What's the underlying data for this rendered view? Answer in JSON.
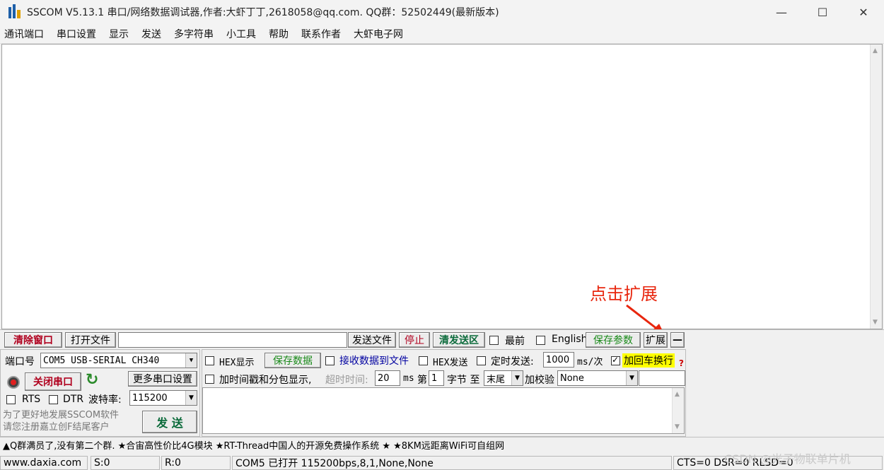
{
  "window": {
    "title": "SSCOM V5.13.1 串口/网络数据调试器,作者:大虾丁丁,2618058@qq.com. QQ群：52502449(最新版本)",
    "min": "—",
    "max": "☐",
    "close": "✕"
  },
  "menu": [
    "通讯端口",
    "串口设置",
    "显示",
    "发送",
    "多字符串",
    "小工具",
    "帮助",
    "联系作者",
    "大虾电子网"
  ],
  "annotation": "点击扩展",
  "toolbar": {
    "clear": "清除窗口",
    "open_file": "打开文件",
    "file_path": "",
    "send_file": "发送文件",
    "stop": "停止",
    "clear_send": "清发送区",
    "top_label": "最前",
    "english_label": "English",
    "save_params": "保存参数",
    "expand": "扩展",
    "collapse": "—"
  },
  "port": {
    "port_label": "端口号",
    "port_value": "COM5 USB-SERIAL CH340",
    "more_settings": "更多串口设置",
    "close_port": "关闭串口",
    "rts": "RTS",
    "dtr": "DTR",
    "baud_label": "波特率:",
    "baud_value": "115200",
    "hint": "为了更好地发展SSCOM软件\n请您注册嘉立创F结尾客户"
  },
  "options": {
    "hex_display": "HEX显示",
    "save_data": "保存数据",
    "recv_to_file": "接收数据到文件",
    "hex_send": "HEX发送",
    "timed_send": "定时发送:",
    "interval": "1000",
    "interval_unit": "ms/次",
    "add_crlf": "加回车换行",
    "timestamp": "加时间戳和分包显示,",
    "timeout_label": "超时时间:",
    "timeout": "20",
    "timeout_unit": "ms",
    "byte_from_label": "第",
    "byte_from": "1",
    "byte_label": "字节 至",
    "byte_to": "末尾",
    "checksum_label": "加校验",
    "checksum": "None",
    "send": "发  送",
    "help": "?"
  },
  "ads": "▲Q群满员了,没有第二个群. ★合宙高性价比4G模块 ★RT-Thread中国人的开源免费操作系统 ★ ★8KM远距离WiFi可自组网",
  "status": {
    "site": "www.daxia.com",
    "s": "S:0",
    "r": "R:0",
    "port_state": "COM5 已打开  115200bps,8,1,None,None",
    "lines": "CTS=0 DSR=0 RLSD=0"
  },
  "watermark": "CSDN @光子物联单片机",
  "colors": {
    "red": "#b0001e",
    "green": "#1a8a1a",
    "annotation": "#e8260e",
    "highlight": "#ffff00"
  }
}
